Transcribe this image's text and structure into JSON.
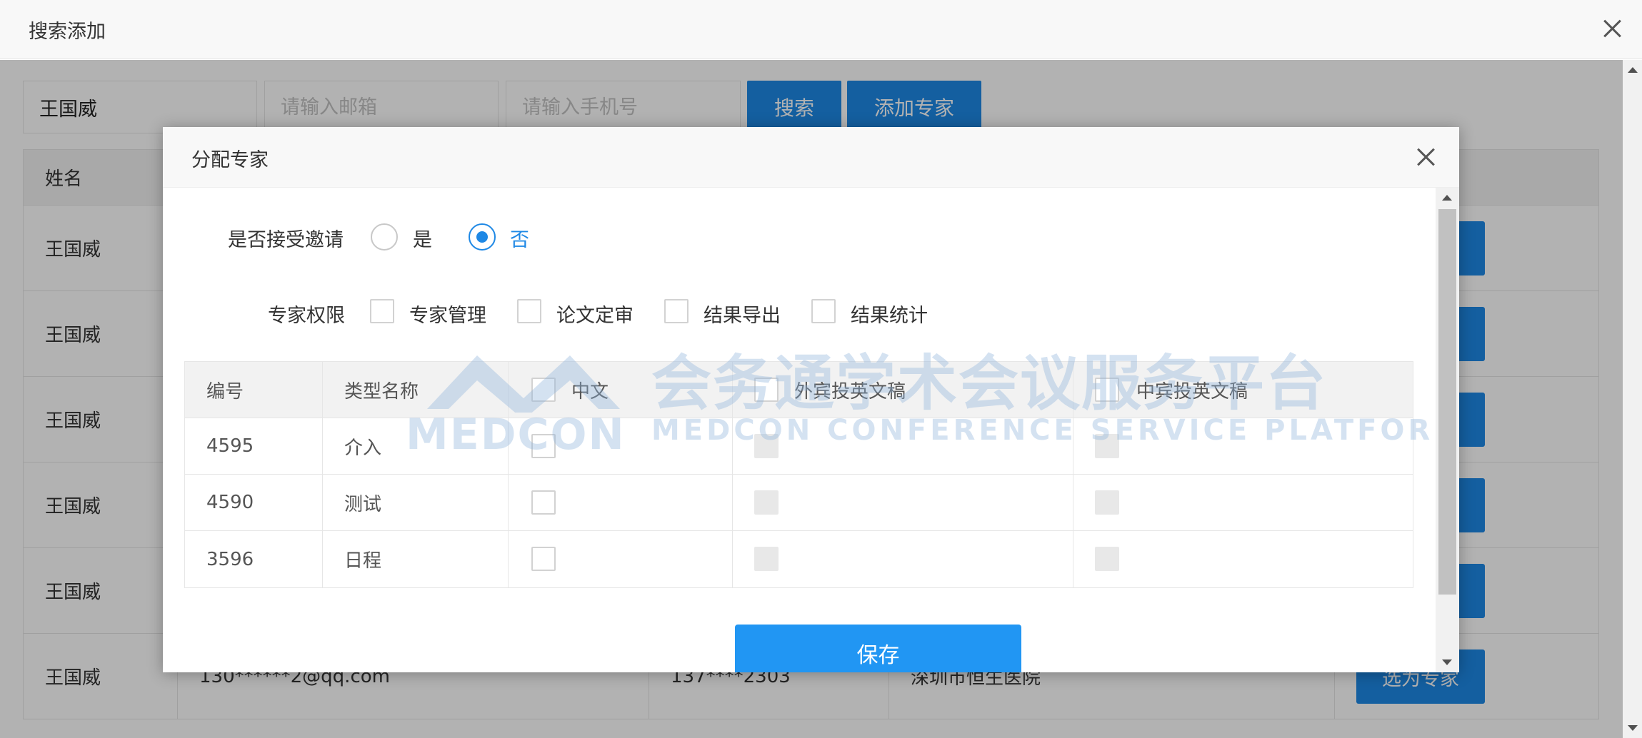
{
  "outer": {
    "title": "搜索添加",
    "search": {
      "name_value": "王国威",
      "email_placeholder": "请输入邮箱",
      "phone_placeholder": "请输入手机号",
      "search_label": "搜索",
      "add_label": "添加专家"
    },
    "table": {
      "header_name": "姓名",
      "rows": [
        {
          "name": "王国威",
          "email": "",
          "phone": "",
          "org": ""
        },
        {
          "name": "王国威",
          "email": "",
          "phone": "",
          "org": ""
        },
        {
          "name": "王国威",
          "email": "",
          "phone": "",
          "org": ""
        },
        {
          "name": "王国威",
          "email": "",
          "phone": "",
          "org": ""
        },
        {
          "name": "王国威",
          "email": "",
          "phone": "",
          "org": ""
        },
        {
          "name": "王国威",
          "email": "130******2@qq.com",
          "phone": "137****2303",
          "org": "深圳市恒生医院",
          "action": "选为专家"
        }
      ]
    }
  },
  "modal": {
    "title": "分配专家",
    "accept": {
      "label": "是否接受邀请",
      "yes": "是",
      "no": "否",
      "selected": "否"
    },
    "permissions": {
      "label": "专家权限",
      "items": [
        "专家管理",
        "论文定审",
        "结果导出",
        "结果统计"
      ]
    },
    "table": {
      "headers": [
        "编号",
        "类型名称",
        "中文",
        "外宾投英文稿",
        "中宾投英文稿"
      ],
      "rows": [
        {
          "id": "4595",
          "name": "介入"
        },
        {
          "id": "4590",
          "name": "测试"
        },
        {
          "id": "3596",
          "name": "日程"
        }
      ]
    },
    "watermark": {
      "cn": "会务通学术会议服务平台",
      "en": "MEDCON CONFERENCE SERVICE PLATFORM",
      "logo": "MEDCON"
    },
    "save_label": "保存"
  }
}
